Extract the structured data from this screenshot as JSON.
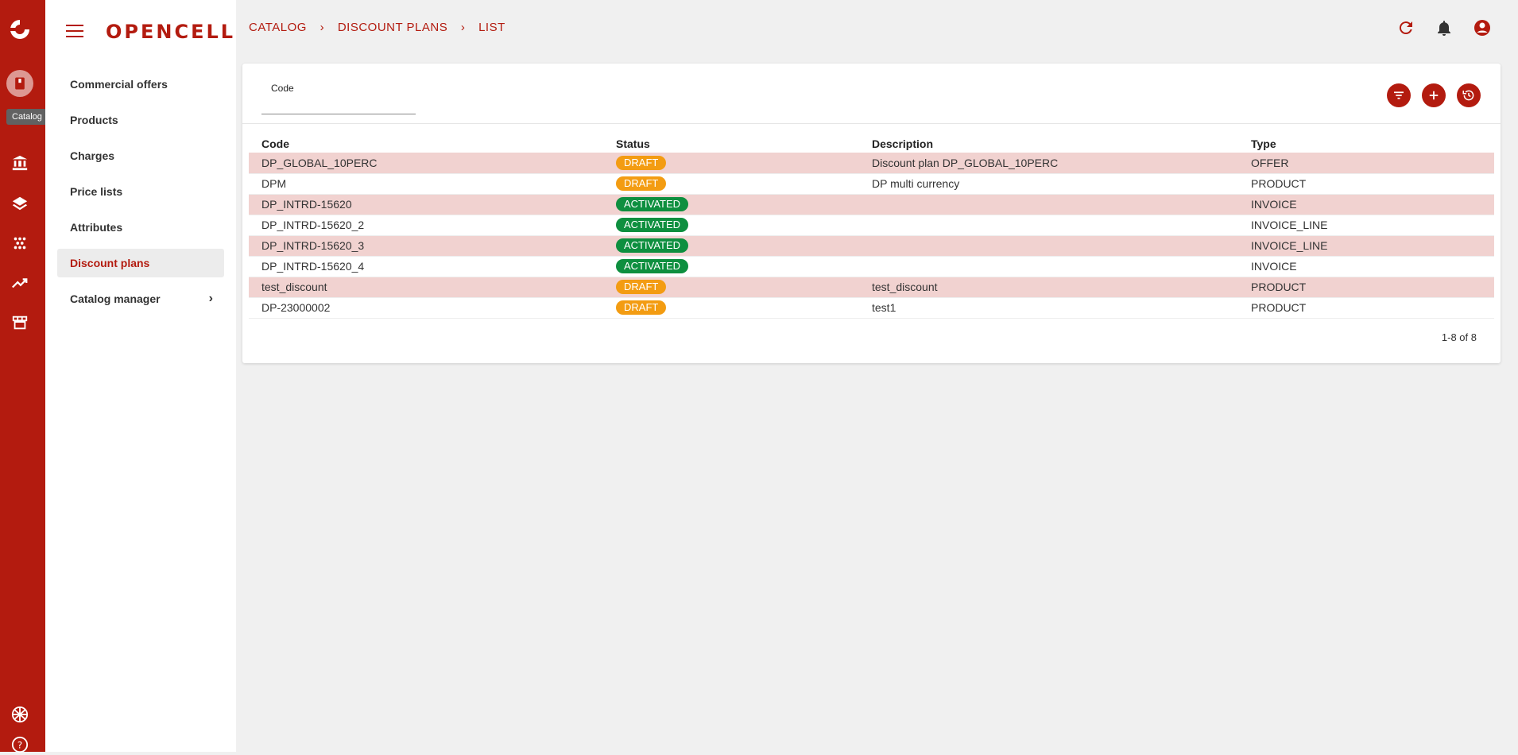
{
  "app": {
    "brand": "OPENCELL"
  },
  "rail": {
    "tooltip": "Catalog"
  },
  "sidebar": {
    "items": [
      {
        "label": "Commercial offers"
      },
      {
        "label": "Products"
      },
      {
        "label": "Charges"
      },
      {
        "label": "Price lists"
      },
      {
        "label": "Attributes"
      },
      {
        "label": "Discount plans"
      },
      {
        "label": "Catalog manager"
      }
    ]
  },
  "breadcrumb": {
    "items": [
      "CATALOG",
      "DISCOUNT PLANS",
      "LIST"
    ]
  },
  "filter": {
    "code_label": "Code",
    "code_value": ""
  },
  "table": {
    "headers": [
      "Code",
      "Status",
      "Description",
      "Type"
    ],
    "rows": [
      {
        "code": "DP_GLOBAL_10PERC",
        "status": "DRAFT",
        "description": "Discount plan DP_GLOBAL_10PERC",
        "type": "OFFER"
      },
      {
        "code": "DPM",
        "status": "DRAFT",
        "description": "DP multi currency",
        "type": "PRODUCT"
      },
      {
        "code": "DP_INTRD-15620",
        "status": "ACTIVATED",
        "description": "",
        "type": "INVOICE"
      },
      {
        "code": "DP_INTRD-15620_2",
        "status": "ACTIVATED",
        "description": "",
        "type": "INVOICE_LINE"
      },
      {
        "code": "DP_INTRD-15620_3",
        "status": "ACTIVATED",
        "description": "",
        "type": "INVOICE_LINE"
      },
      {
        "code": "DP_INTRD-15620_4",
        "status": "ACTIVATED",
        "description": "",
        "type": "INVOICE"
      },
      {
        "code": "test_discount",
        "status": "DRAFT",
        "description": "test_discount",
        "type": "PRODUCT"
      },
      {
        "code": "DP-23000002",
        "status": "DRAFT",
        "description": "test1",
        "type": "PRODUCT"
      }
    ]
  },
  "pager": {
    "text": "1-8 of 8"
  },
  "colors": {
    "brand": "#b31b0f",
    "draft": "#f39c12",
    "activated": "#0e8f3f",
    "row_highlight": "#f1d2d0"
  }
}
